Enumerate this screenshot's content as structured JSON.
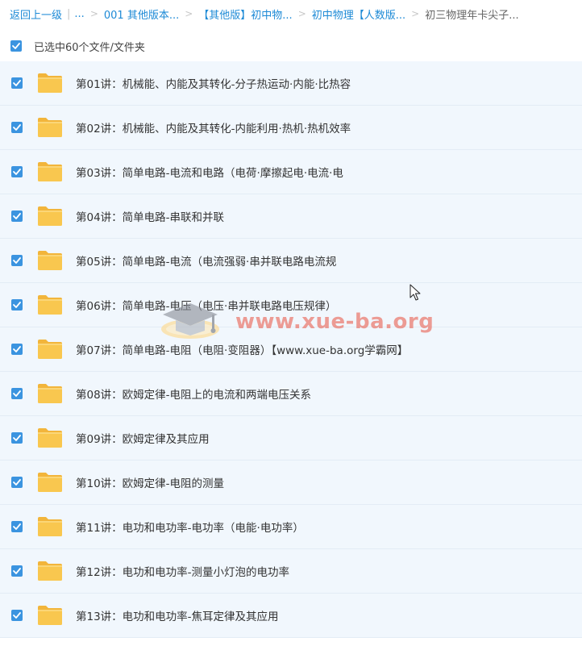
{
  "breadcrumb": {
    "back": "返回上一级",
    "ellipsis": "...",
    "items": [
      "001 其他版本...",
      "【其他版】初中物...",
      "初中物理【人数版...",
      "初三物理年卡尖子..."
    ]
  },
  "select_all": {
    "label": "已选中60个文件/文件夹",
    "checked": true
  },
  "files": [
    {
      "name": "第01讲：机械能、内能及其转化-分子热运动·内能·比热容",
      "checked": true
    },
    {
      "name": "第02讲：机械能、内能及其转化-内能利用·热机·热机效率",
      "checked": true
    },
    {
      "name": "第03讲：简单电路-电流和电路（电荷·摩擦起电·电流·电",
      "checked": true
    },
    {
      "name": "第04讲：简单电路-串联和并联",
      "checked": true
    },
    {
      "name": "第05讲：简单电路-电流（电流强弱·串并联电路电流规",
      "checked": true
    },
    {
      "name": "第06讲：简单电路-电压（电压·串并联电路电压规律）",
      "checked": true
    },
    {
      "name": "第07讲：简单电路-电阻（电阻·变阻器）【www.xue-ba.org学霸网】",
      "checked": true
    },
    {
      "name": "第08讲：欧姆定律-电阻上的电流和两端电压关系",
      "checked": true
    },
    {
      "name": "第09讲：欧姆定律及其应用",
      "checked": true
    },
    {
      "name": "第10讲：欧姆定律-电阻的测量",
      "checked": true
    },
    {
      "name": "第11讲：电功和电功率-电功率（电能·电功率）",
      "checked": true
    },
    {
      "name": "第12讲：电功和电功率-测量小灯泡的电功率",
      "checked": true
    },
    {
      "name": "第13讲：电功和电功率-焦耳定律及其应用",
      "checked": true
    }
  ],
  "watermark": {
    "text": "www.xue-ba.org"
  },
  "colors": {
    "link": "#1d8ad6",
    "checkbox": "#3b94e0",
    "row_bg": "#f1f7fd",
    "folder": "#f9c74f",
    "watermark_text": "#e86254"
  },
  "icons": {
    "folder": "folder-icon",
    "checkbox": "checkmark-icon",
    "cursor": "mouse-pointer-icon",
    "watermark_logo": "graduation-cap-icon"
  }
}
